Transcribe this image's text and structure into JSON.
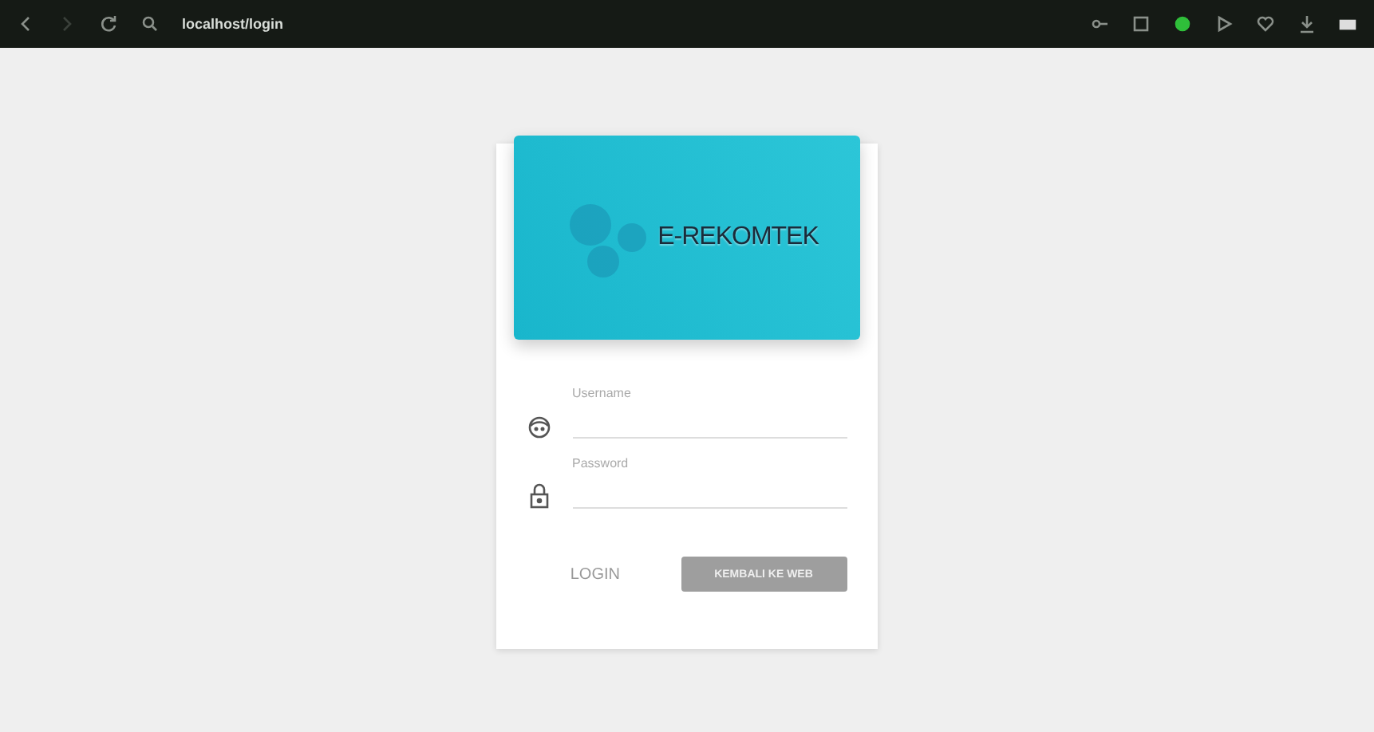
{
  "browser": {
    "url": "localhost/login"
  },
  "logo": {
    "text": "E-REKOMTEK"
  },
  "fields": [
    {
      "kind": "user",
      "placeholder": "Username"
    },
    {
      "kind": "lock",
      "placeholder": "Password"
    }
  ],
  "actions": {
    "login": "LOGIN",
    "back": "KEMBALI KE WEB"
  }
}
